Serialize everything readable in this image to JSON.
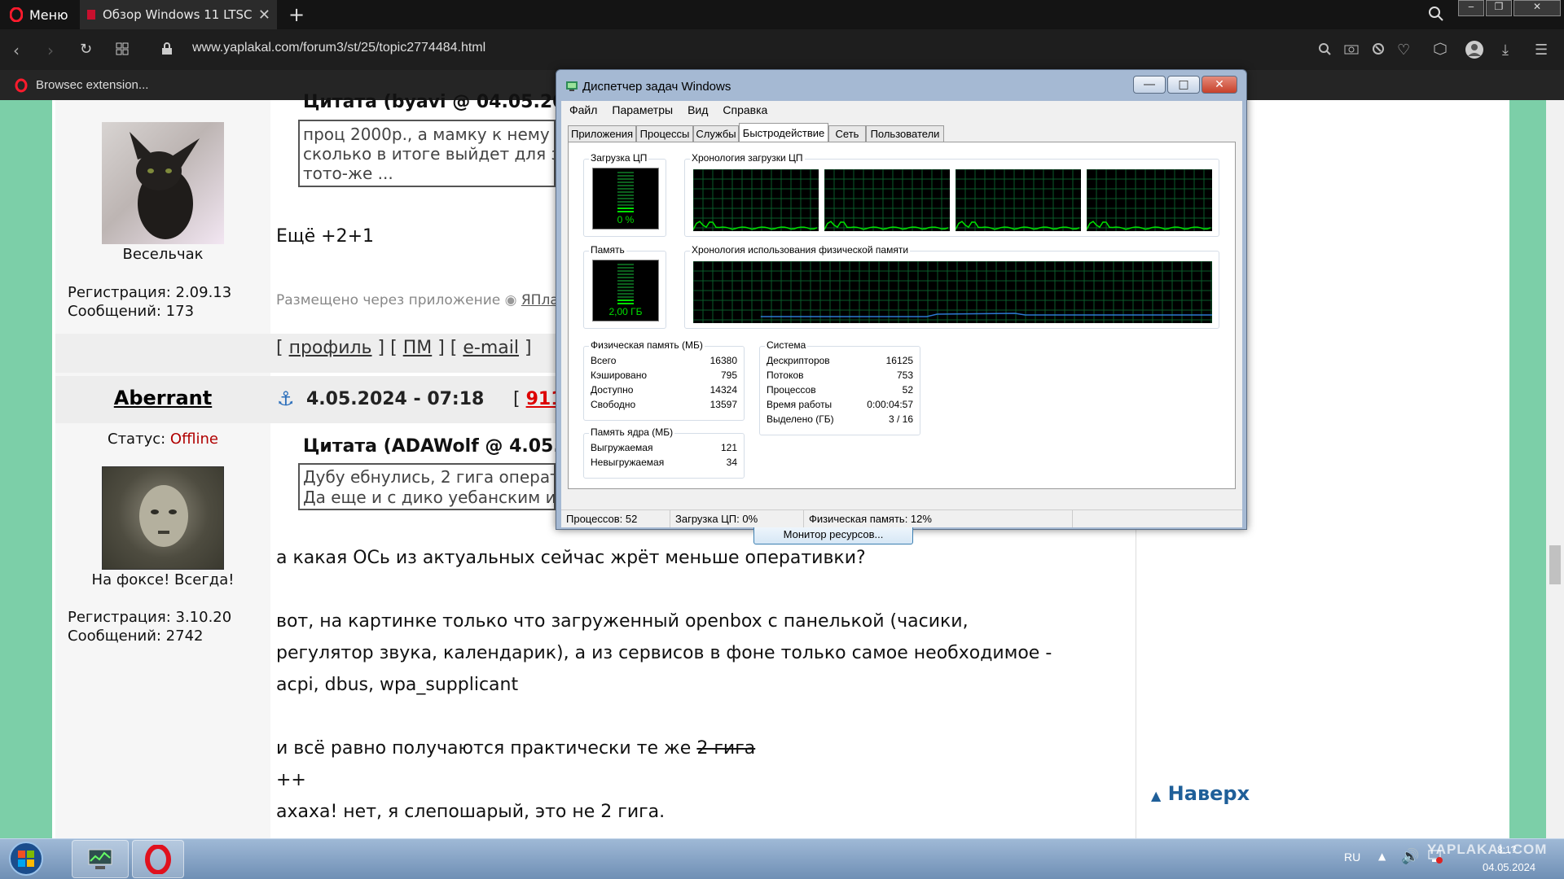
{
  "browser": {
    "menu_label": "Меню",
    "tab_title": "Обзор Windows 11 LTSC –",
    "url": "www.yaplakal.com/forum3/st/25/topic2774484.html",
    "extension_label": "Browsec extension..."
  },
  "forum": {
    "post1": {
      "user_caption": "Весельчак",
      "registration": "Регистрация: 2.09.13",
      "messages": "Сообщений: 173",
      "quote_header": "Цитата (byavi @ 04.05.20",
      "quote_lines": [
        "проц 2000р., а мамку к нему",
        "сколько в итоге выйдет для з",
        "тото-же ..."
      ],
      "body": "Ещё +2+1",
      "posted_via": "Размещено через приложение",
      "app_link": "ЯПла",
      "links": {
        "profile": "профиль",
        "pm": "ПМ",
        "email": "e-mail"
      }
    },
    "post2": {
      "username": "Aberrant",
      "date": "4.05.2024 - 07:18",
      "rating_partial": "911",
      "status_label": "Статус:",
      "status_value": "Offline",
      "user_caption": "На фоксе! Всегда!",
      "registration": "Регистрация: 3.10.20",
      "messages": "Сообщений: 2742",
      "quote_header": "Цитата (ADAWolf @ 4.05.2",
      "quote_lines": [
        "Дубу ебнулись, 2 гига операт",
        "Да еще и с дико уебанским и"
      ],
      "body_lines": [
        "а какая ОСь из актуальных сейчас жрёт меньше оперативки?",
        "вот, на картинке только что загруженный openbox с панелькой (часики,",
        "регулятор звука, календарик), а из сервисов в фоне только самое необходимое -",
        "acpi, dbus, wpa_supplicant",
        "и всё равно получаются практически те же",
        "2 гига",
        "++",
        "ахаха! нет, я слепошарый, это не 2 гига."
      ]
    },
    "to_top": "Наверх"
  },
  "taskmanager": {
    "title": "Диспетчер задач Windows",
    "menu": [
      "Файл",
      "Параметры",
      "Вид",
      "Справка"
    ],
    "tabs": [
      "Приложения",
      "Процессы",
      "Службы",
      "Быстродействие",
      "Сеть",
      "Пользователи"
    ],
    "active_tab": "Быстродействие",
    "cpu_group": "Загрузка ЦП",
    "cpu_value": "0 %",
    "cpu_history_group": "Хронология загрузки ЦП",
    "mem_group": "Память",
    "mem_value": "2,00 ГБ",
    "mem_history_group": "Хронология использования физической памяти",
    "phys_mem": {
      "title": "Физическая память (МБ)",
      "rows": [
        {
          "k": "Всего",
          "v": "16380"
        },
        {
          "k": "Кэшировано",
          "v": "795"
        },
        {
          "k": "Доступно",
          "v": "14324"
        },
        {
          "k": "Свободно",
          "v": "13597"
        }
      ]
    },
    "system": {
      "title": "Система",
      "rows": [
        {
          "k": "Дескрипторов",
          "v": "16125"
        },
        {
          "k": "Потоков",
          "v": "753"
        },
        {
          "k": "Процессов",
          "v": "52"
        },
        {
          "k": "Время работы",
          "v": "0:00:04:57"
        },
        {
          "k": "Выделено (ГБ)",
          "v": "3 / 16"
        }
      ]
    },
    "kernel_mem": {
      "title": "Память ядра (МБ)",
      "rows": [
        {
          "k": "Выгружаемая",
          "v": "121"
        },
        {
          "k": "Невыгружаемая",
          "v": "34"
        }
      ]
    },
    "monitor_button": "Монитор ресурсов...",
    "status": {
      "processes": "Процессов: 52",
      "cpu": "Загрузка ЦП: 0%",
      "memory": "Физическая память: 12%"
    }
  },
  "taskbar": {
    "lang": "RU",
    "clock_time": "8:1?",
    "clock_date": "04.05.2024",
    "watermark": "YAPLAKAL.COM"
  }
}
